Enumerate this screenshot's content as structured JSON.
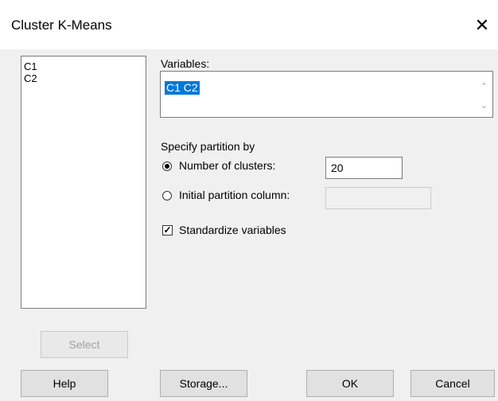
{
  "window": {
    "title": "Cluster K-Means",
    "close_glyph": "✕"
  },
  "source_list": {
    "items": [
      "C1",
      "C2"
    ]
  },
  "variables": {
    "label": "Variables:",
    "value": "C1 C2"
  },
  "partition": {
    "heading": "Specify partition by",
    "number_of_clusters": {
      "label": "Number of clusters:",
      "selected": true,
      "value": "20"
    },
    "initial_partition_column": {
      "label": "Initial partition column:",
      "selected": false,
      "value": ""
    }
  },
  "standardize": {
    "label": "Standardize variables",
    "checked": true,
    "mark": "✓"
  },
  "buttons": {
    "select": "Select",
    "help": "Help",
    "storage": "Storage...",
    "ok": "OK",
    "cancel": "Cancel"
  }
}
